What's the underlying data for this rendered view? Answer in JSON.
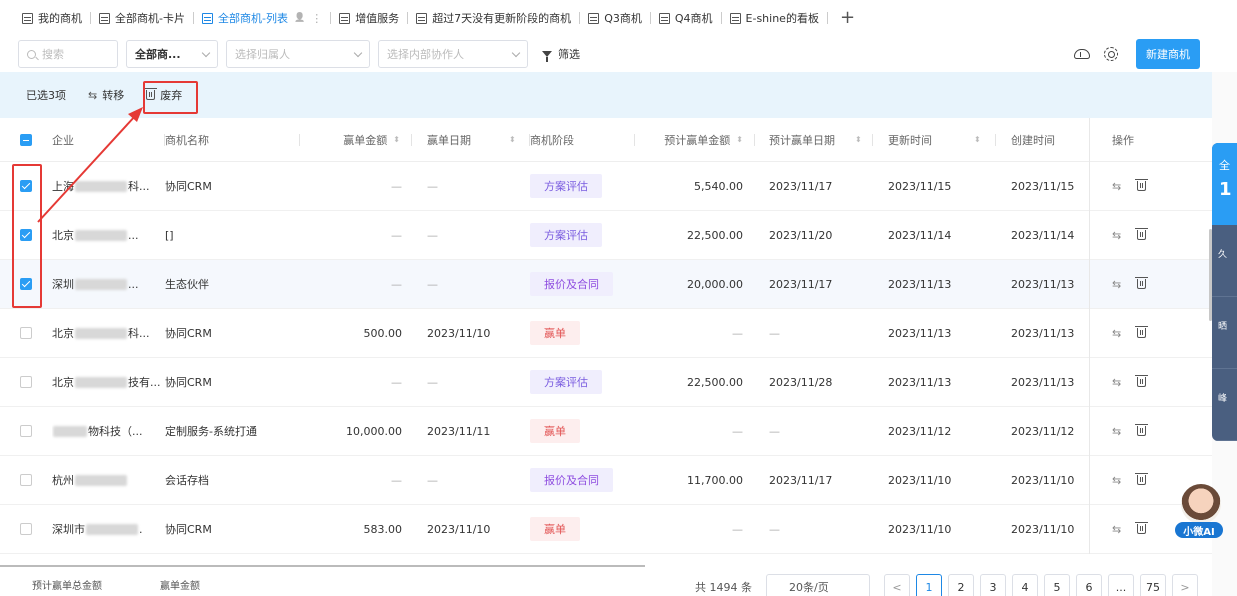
{
  "tabs": [
    {
      "label": "我的商机",
      "active": false
    },
    {
      "label": "全部商机-卡片",
      "active": false
    },
    {
      "label": "全部商机-列表",
      "active": true
    },
    {
      "label": "增值服务",
      "active": false
    },
    {
      "label": "超过7天没有更新阶段的商机",
      "active": false
    },
    {
      "label": "Q3商机",
      "active": false
    },
    {
      "label": "Q4商机",
      "active": false
    },
    {
      "label": "E-shine的看板",
      "active": false
    }
  ],
  "tab_add": "+",
  "tab_extra": "⋮",
  "filters": {
    "search_placeholder": "搜索",
    "scope": "全部商...",
    "owner_placeholder": "选择归属人",
    "collab_placeholder": "选择内部协作人",
    "filter_label": "筛选"
  },
  "new_button": "新建商机",
  "selection": {
    "count": "已选3项",
    "transfer": "转移",
    "abandon": "废弃"
  },
  "columns": {
    "company": "企业",
    "name": "商机名称",
    "amount": "赢单金额",
    "date": "赢单日期",
    "stage": "商机阶段",
    "expected_amount": "预计赢单金额",
    "expected_date": "预计赢单日期",
    "updated": "更新时间",
    "created": "创建时间",
    "ops": "操作"
  },
  "rows": [
    {
      "checked": true,
      "company": "上海",
      "company_tail": "科...",
      "name": "协同CRM",
      "amount": "—",
      "date": "—",
      "stage": "方案评估",
      "stage_type": "eval",
      "expected_amount": "5,540.00",
      "expected_date": "2023/11/17",
      "updated": "2023/11/15",
      "created": "2023/11/15"
    },
    {
      "checked": true,
      "company": "北京",
      "company_tail": "...",
      "name": "[]",
      "amount": "—",
      "date": "—",
      "stage": "方案评估",
      "stage_type": "eval",
      "expected_amount": "22,500.00",
      "expected_date": "2023/11/20",
      "updated": "2023/11/14",
      "created": "2023/11/14"
    },
    {
      "checked": true,
      "company": "深圳",
      "company_tail": "...",
      "name": "生态伙伴",
      "amount": "—",
      "date": "—",
      "stage": "报价及合同",
      "stage_type": "quote",
      "expected_amount": "20,000.00",
      "expected_date": "2023/11/17",
      "updated": "2023/11/13",
      "created": "2023/11/13"
    },
    {
      "checked": false,
      "company": "北京",
      "company_tail": "科...",
      "name": "协同CRM",
      "amount": "500.00",
      "date": "2023/11/10",
      "stage": "赢单",
      "stage_type": "win",
      "expected_amount": "—",
      "expected_date": "—",
      "updated": "2023/11/13",
      "created": "2023/11/13"
    },
    {
      "checked": false,
      "company": "北京",
      "company_tail": "技有...",
      "name": "协同CRM",
      "amount": "—",
      "date": "—",
      "stage": "方案评估",
      "stage_type": "eval",
      "expected_amount": "22,500.00",
      "expected_date": "2023/11/28",
      "updated": "2023/11/13",
      "created": "2023/11/13"
    },
    {
      "checked": false,
      "company": "",
      "company_tail": "物科技（...",
      "name": "定制服务-系统打通",
      "amount": "10,000.00",
      "date": "2023/11/11",
      "stage": "赢单",
      "stage_type": "win",
      "expected_amount": "—",
      "expected_date": "—",
      "updated": "2023/11/12",
      "created": "2023/11/12"
    },
    {
      "checked": false,
      "company": "杭州",
      "company_tail": "",
      "name": "会话存档",
      "amount": "—",
      "date": "—",
      "stage": "报价及合同",
      "stage_type": "quote",
      "expected_amount": "11,700.00",
      "expected_date": "2023/11/17",
      "updated": "2023/11/10",
      "created": "2023/11/10"
    },
    {
      "checked": false,
      "company": "深圳市",
      "company_tail": ".",
      "name": "协同CRM",
      "amount": "583.00",
      "date": "2023/11/10",
      "stage": "赢单",
      "stage_type": "win",
      "expected_amount": "—",
      "expected_date": "—",
      "updated": "2023/11/10",
      "created": "2023/11/10"
    }
  ],
  "footer": {
    "sum_label": "预计赢单总金额",
    "amount_label": "赢单金额",
    "total": "共 1494 条",
    "page_size": "20条/页",
    "pages": [
      "1",
      "2",
      "3",
      "4",
      "5",
      "6",
      "...",
      "75"
    ],
    "prev": "<",
    "next": ">"
  },
  "side_panel": {
    "top_label": "全",
    "top_number": "1",
    "items": [
      "久",
      "晒",
      "峰"
    ]
  },
  "ai_badge": "小微AI",
  "colors": {
    "accent": "#2a9df4",
    "highlight_red": "#e53935",
    "stage_eval": "#7a5ce0",
    "stage_win": "#e25555"
  }
}
